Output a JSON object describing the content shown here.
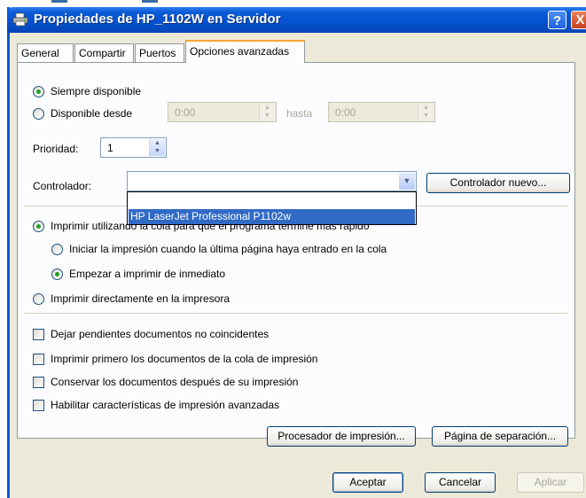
{
  "window": {
    "title": "Propiedades de HP_1102W en Servidor",
    "help_button": "?",
    "close_button": "X",
    "icon": "printer-icon"
  },
  "tabs": [
    {
      "label": "General",
      "active": false
    },
    {
      "label": "Compartir",
      "active": false
    },
    {
      "label": "Puertos",
      "active": false
    },
    {
      "label": "Opciones avanzadas",
      "active": true
    }
  ],
  "availability": {
    "always_label": "Siempre disponible",
    "always_checked": true,
    "from_label": "Disponible desde",
    "from_value": "0:00",
    "until_label": "hasta",
    "until_value": "0:00"
  },
  "priority": {
    "label": "Prioridad:",
    "value": "1"
  },
  "driver": {
    "label": "Controlador:",
    "selected_value": "",
    "new_driver_button": "Controlador nuevo...",
    "dropdown_options": [
      "HP LaserJet Professional P1102w"
    ]
  },
  "spool": {
    "spool_label": "Imprimir utilizando la cola para que el programa termine más rápido",
    "spool_checked": true,
    "last_page_label": "Iniciar la impresión cuando la última página haya entrado en la cola",
    "last_page_checked": false,
    "immediate_label": "Empezar a imprimir de inmediato",
    "immediate_checked": true,
    "direct_label": "Imprimir directamente en la impresora",
    "direct_checked": false
  },
  "options": [
    {
      "label": "Dejar pendientes documentos no coincidentes",
      "checked": false
    },
    {
      "label": "Imprimir primero los documentos de la cola de impresión",
      "checked": false
    },
    {
      "label": "Conservar los documentos después de su impresión",
      "checked": false
    },
    {
      "label": "Habilitar características de impresión avanzadas",
      "checked": false
    }
  ],
  "panel_buttons": {
    "print_processor": "Procesador de impresión...",
    "separator_page": "Página de separación..."
  },
  "dialog_buttons": {
    "ok": "Aceptar",
    "cancel": "Cancelar",
    "apply": "Aplicar"
  },
  "colors": {
    "titlebar": "#0a5ad6",
    "active_tab_accent": "#f4a732",
    "selection": "#316ac5",
    "radio_dot": "#21a121"
  }
}
